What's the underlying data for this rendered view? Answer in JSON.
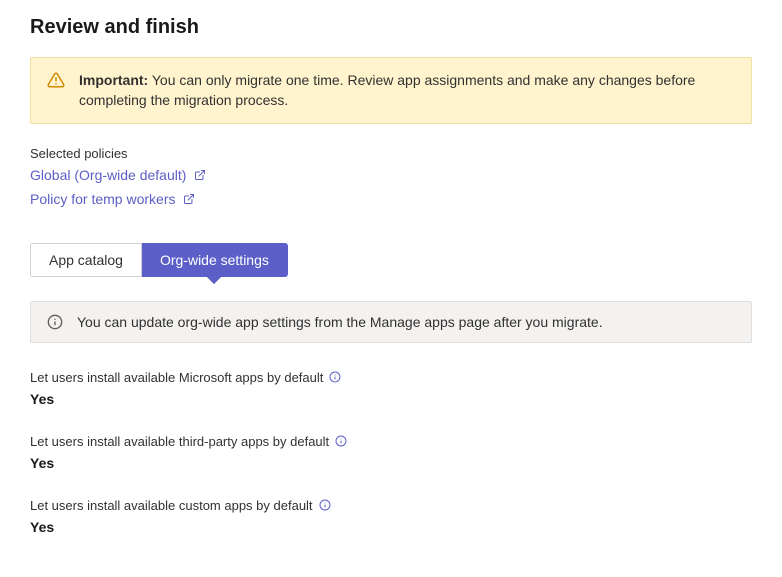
{
  "header": {
    "title": "Review and finish"
  },
  "warning": {
    "strong": "Important:",
    "body": "You can only migrate one time. Review app assignments and make any changes before completing the migration process."
  },
  "policies": {
    "label": "Selected policies",
    "items": [
      {
        "label": "Global (Org-wide default)"
      },
      {
        "label": "Policy for temp workers"
      }
    ]
  },
  "tabs": {
    "catalog": "App catalog",
    "orgwide": "Org-wide settings"
  },
  "info_bar": {
    "text": "You can update org-wide app settings from the Manage apps page after you migrate."
  },
  "settings": [
    {
      "label": "Let users install available Microsoft apps by default",
      "value": "Yes"
    },
    {
      "label": "Let users install available third-party apps by default",
      "value": "Yes"
    },
    {
      "label": "Let users install available custom apps by default",
      "value": "Yes"
    }
  ]
}
